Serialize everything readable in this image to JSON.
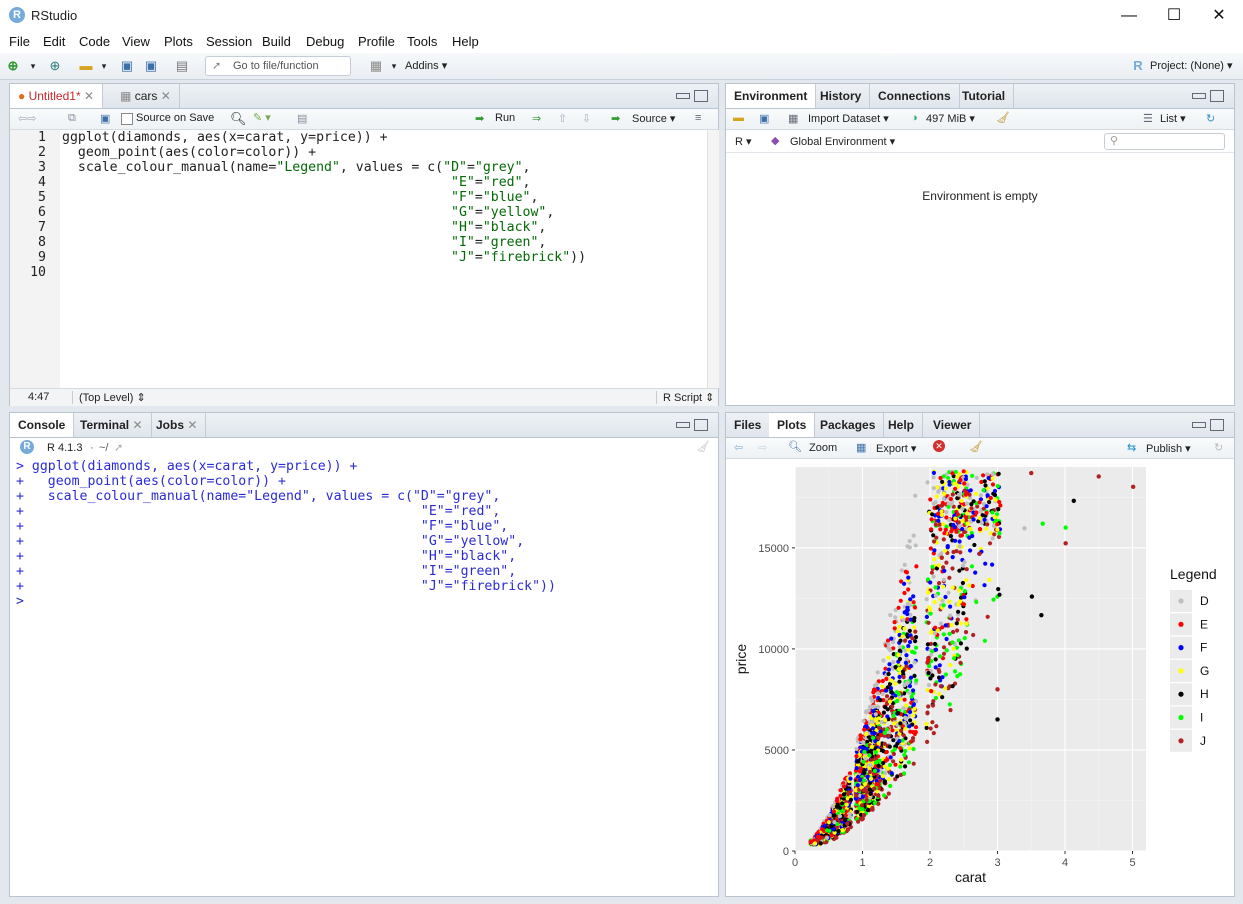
{
  "window": {
    "title": "RStudio",
    "logo": "R",
    "minimize": "—",
    "maximize": "☐",
    "close": "✕"
  },
  "menu": [
    "File",
    "Edit",
    "Code",
    "View",
    "Plots",
    "Session",
    "Build",
    "Debug",
    "Profile",
    "Tools",
    "Help"
  ],
  "toolbar": {
    "goto_placeholder": "Go to file/function",
    "addins": "Addins",
    "project": "Project: (None)"
  },
  "source": {
    "tabs": [
      "Untitled1*",
      "cars"
    ],
    "source_on_save": "Source on Save",
    "run": "Run",
    "source_btn": "Source",
    "line_numbers": [
      "1",
      "2",
      "3",
      "4",
      "5",
      "6",
      "7",
      "8",
      "9",
      "10"
    ],
    "code_lines": [
      "ggplot(diamonds, aes(x=carat, y=price)) +",
      "  geom_point(aes(color=color)) +",
      "  scale_colour_manual(name=\"Legend\", values = c(\"D\"=\"grey\",",
      "                                                 \"E\"=\"red\",",
      "                                                 \"F\"=\"blue\",",
      "                                                 \"G\"=\"yellow\",",
      "                                                 \"H\"=\"black\",",
      "                                                 \"I\"=\"green\",",
      "                                                 \"J\"=\"firebrick\"))",
      ""
    ],
    "status_pos": "4:47",
    "status_scope": "(Top Level) ⇕",
    "status_type": "R Script ⇕"
  },
  "env": {
    "tabs": [
      "Environment",
      "History",
      "Connections",
      "Tutorial"
    ],
    "import": "Import Dataset",
    "memory": "497 MiB",
    "list": "List",
    "lang": "R",
    "global": "Global Environment",
    "empty": "Environment is empty"
  },
  "console": {
    "tabs": [
      "Console",
      "Terminal",
      "Jobs"
    ],
    "version": "R 4.1.3",
    "path": "~/",
    "lines": [
      "> ggplot(diamonds, aes(x=carat, y=price)) +",
      "+   geom_point(aes(color=color)) +",
      "+   scale_colour_manual(name=\"Legend\", values = c(\"D\"=\"grey\",",
      "+                                                  \"E\"=\"red\",",
      "+                                                  \"F\"=\"blue\",",
      "+                                                  \"G\"=\"yellow\",",
      "+                                                  \"H\"=\"black\",",
      "+                                                  \"I\"=\"green\",",
      "+                                                  \"J\"=\"firebrick\"))",
      "> "
    ]
  },
  "files": {
    "tabs": [
      "Files",
      "Plots",
      "Packages",
      "Help",
      "Viewer"
    ],
    "zoom": "Zoom",
    "export": "Export",
    "publish": "Publish"
  },
  "chart_data": {
    "type": "scatter",
    "xlabel": "carat",
    "ylabel": "price",
    "xlim": [
      0,
      5.2
    ],
    "ylim": [
      0,
      19000
    ],
    "xticks": [
      0,
      1,
      2,
      3,
      4,
      5
    ],
    "yticks": [
      0,
      5000,
      10000,
      15000
    ],
    "ytick_labels": [
      "0",
      "5000",
      "10000",
      "15000"
    ],
    "grid": true,
    "legend_title": "Legend",
    "legend_position": "right",
    "series": [
      {
        "name": "D",
        "color": "#bebebe"
      },
      {
        "name": "E",
        "color": "#ff0000"
      },
      {
        "name": "F",
        "color": "#0000ff"
      },
      {
        "name": "G",
        "color": "#ffff00"
      },
      {
        "name": "H",
        "color": "#000000"
      },
      {
        "name": "I",
        "color": "#00ff00"
      },
      {
        "name": "J",
        "color": "#b22222"
      }
    ],
    "outliers": [
      {
        "series": "J",
        "x": 5.01,
        "y": 18018
      },
      {
        "series": "J",
        "x": 4.5,
        "y": 18531
      },
      {
        "series": "H",
        "x": 4.13,
        "y": 17329
      },
      {
        "series": "I",
        "x": 4.01,
        "y": 16000
      },
      {
        "series": "J",
        "x": 4.01,
        "y": 15223
      },
      {
        "series": "I",
        "x": 3.67,
        "y": 16193
      },
      {
        "series": "J",
        "x": 3.5,
        "y": 18701
      },
      {
        "series": "H",
        "x": 3.51,
        "y": 12587
      },
      {
        "series": "H",
        "x": 3.65,
        "y": 11668
      },
      {
        "series": "D",
        "x": 3.4,
        "y": 15964
      },
      {
        "series": "H",
        "x": 3.0,
        "y": 6512
      },
      {
        "series": "J",
        "x": 3.0,
        "y": 8000
      }
    ]
  }
}
